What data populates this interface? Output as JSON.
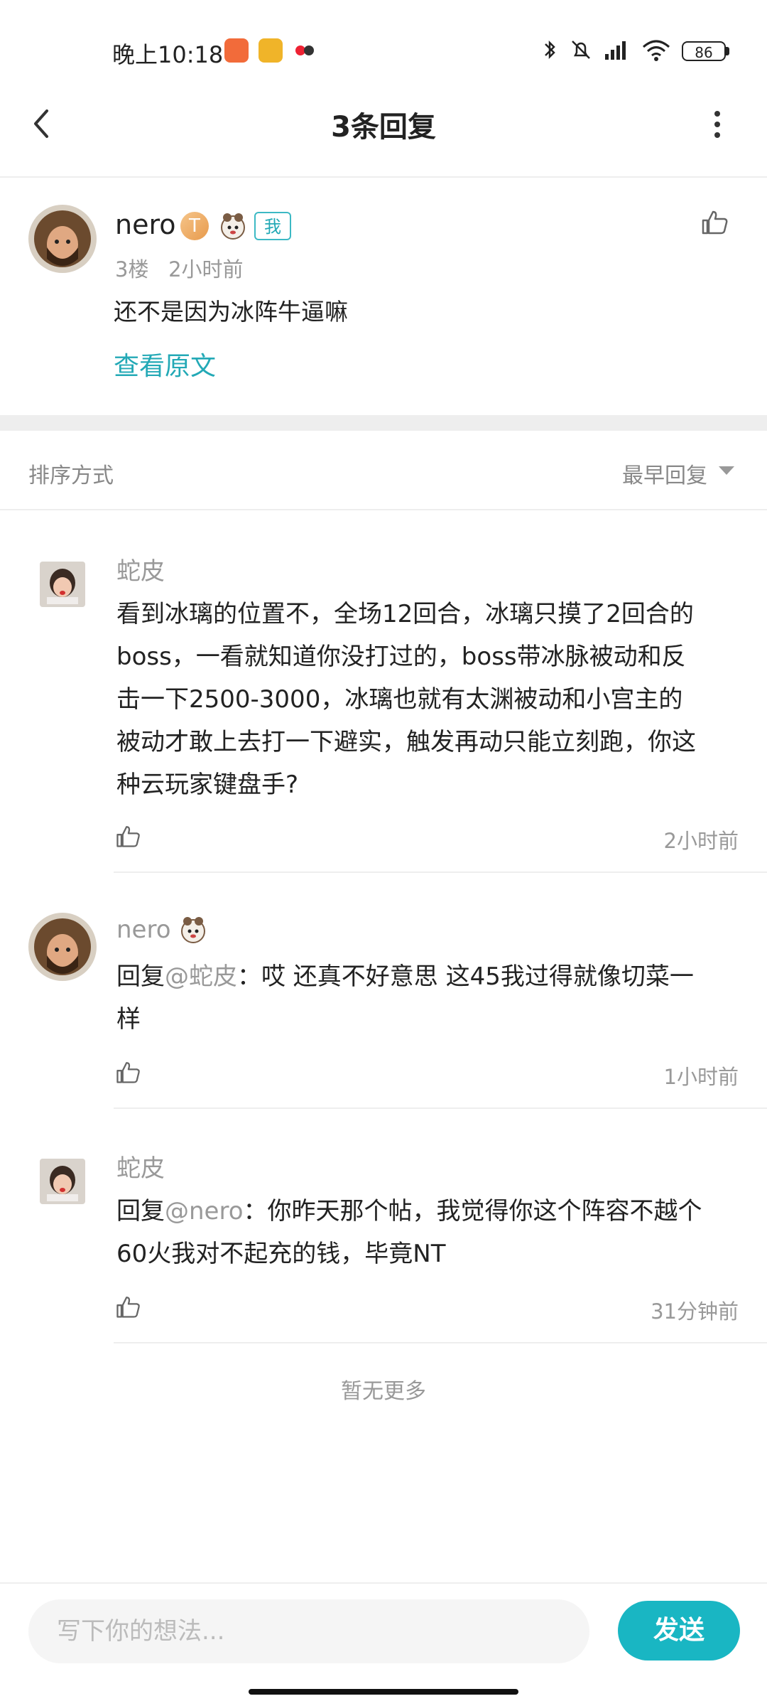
{
  "status_bar": {
    "time": "晚上10:18",
    "battery": "86"
  },
  "header": {
    "title": "3条回复"
  },
  "main_comment": {
    "username": "nero",
    "level_badge": "T",
    "me_badge": "我",
    "meta": "3楼   2小时前",
    "text": "还不是因为冰阵牛逼嘛",
    "view_original": "查看原文"
  },
  "sort": {
    "label": "排序方式",
    "value": "最早回复"
  },
  "replies": [
    {
      "username": "蛇皮",
      "text": "看到冰璃的位置不，全场12回合，冰璃只摸了2回合的\nboss，一看就知道你没打过的，boss带冰脉被动和反\n击一下2500-3000，冰璃也就有太渊被动和小宫主的\n被动才敢上去打一下避实，触发再动只能立刻跑，你这\n种云玩家键盘手?",
      "time": "2小时前"
    },
    {
      "username": "nero",
      "reply_prefix": "回复",
      "mention": "@蛇皮",
      "text": "：哎 还真不好意思 这45我过得就像切菜一\n样",
      "time": "1小时前"
    },
    {
      "username": "蛇皮",
      "reply_prefix": "回复",
      "mention": "@nero",
      "text": "：你昨天那个帖，我觉得你这个阵容不越个\n60火我对不起充的钱，毕竟NT",
      "time": "31分钟前"
    }
  ],
  "footer": {
    "no_more": "暂无更多"
  },
  "bottom_bar": {
    "placeholder": "写下你的想法...",
    "send_label": "发送"
  },
  "colors": {
    "accent": "#19b6c3",
    "link": "#23a9b6"
  }
}
